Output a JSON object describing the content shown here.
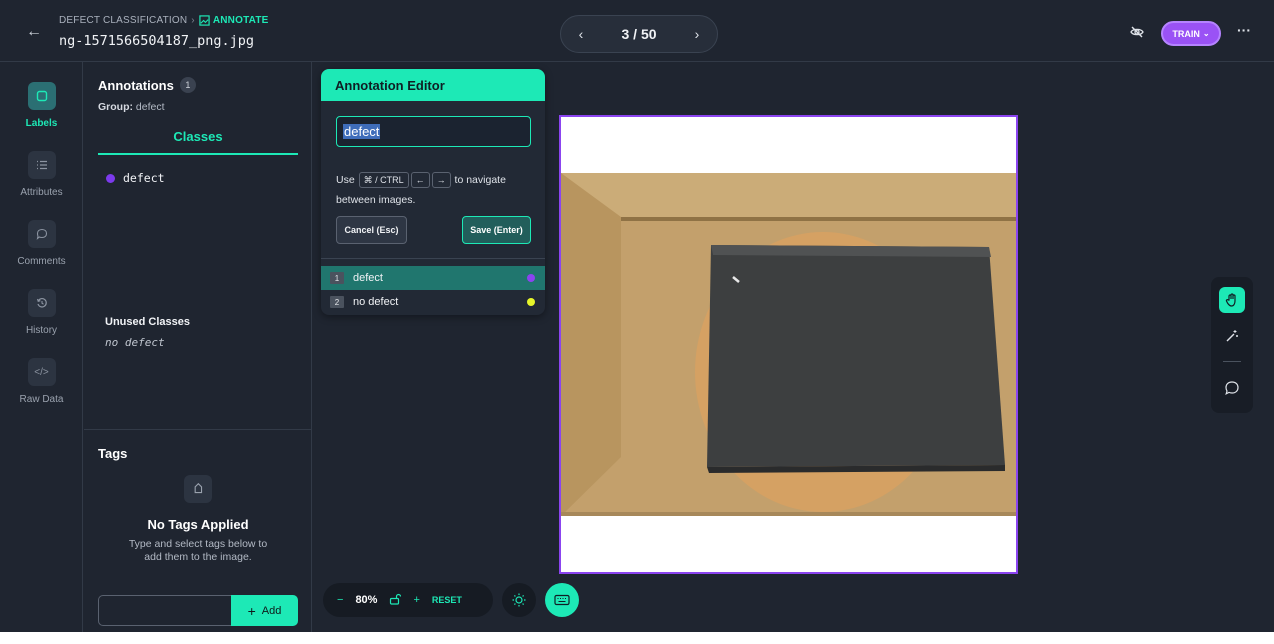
{
  "header": {
    "breadcrumb_parent": "DEFECT CLASSIFICATION",
    "breadcrumb_current": "ANNOTATE",
    "file_name": "ng-1571566504187_png.jpg",
    "pager_text": "3 / 50",
    "train_label": "TRAIN"
  },
  "rail": {
    "items": [
      {
        "label": "Labels",
        "icon": "label-icon"
      },
      {
        "label": "Attributes",
        "icon": "list-icon"
      },
      {
        "label": "Comments",
        "icon": "comment-icon"
      },
      {
        "label": "History",
        "icon": "history-icon"
      },
      {
        "label": "Raw Data",
        "icon": "code-icon"
      }
    ]
  },
  "annotations": {
    "title": "Annotations",
    "count": "1",
    "group_label": "Group:",
    "group_value": "defect",
    "classes_tab": "Classes",
    "classes": [
      {
        "name": "defect",
        "color": "#7c3aed"
      }
    ],
    "unused_title": "Unused Classes",
    "unused": [
      "no defect"
    ]
  },
  "tags": {
    "title": "Tags",
    "empty_title": "No Tags Applied",
    "empty_desc": "Type and select tags below to add them to the image.",
    "input_value": "",
    "add_label": "Add"
  },
  "editor": {
    "title": "Annotation Editor",
    "input_value": "defect",
    "hint_use": "Use",
    "hint_key": "⌘ / CTRL",
    "hint_left": "←",
    "hint_right": "→",
    "hint_rest": "to navigate between images.",
    "cancel_label": "Cancel (Esc)",
    "save_label": "Save (Enter)",
    "options": [
      {
        "num": "1",
        "label": "defect",
        "color": "#8b44f0",
        "selected": true
      },
      {
        "num": "2",
        "label": "no defect",
        "color": "#e6f52a",
        "selected": false
      }
    ]
  },
  "zoom": {
    "minus": "−",
    "value": "80%",
    "plus": "+",
    "reset_label": "RESET"
  },
  "colors": {
    "accent": "#1de9b6",
    "train": "#9a52f5",
    "image_border": "#8b44f0"
  }
}
